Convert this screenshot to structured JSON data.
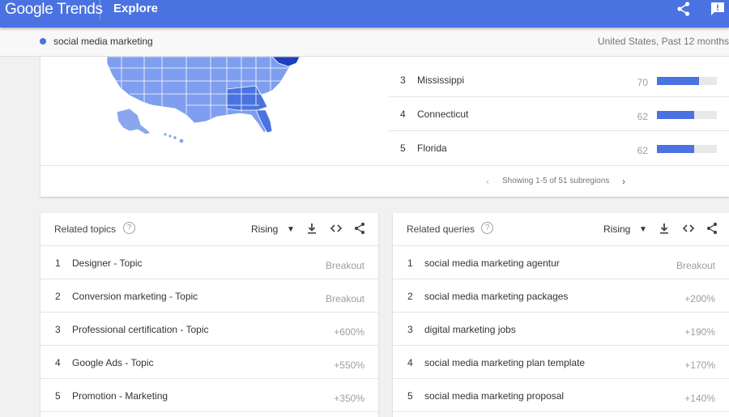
{
  "header": {
    "logo_google": "Google",
    "logo_trends": "Trends",
    "section": "Explore"
  },
  "search": {
    "term": "social media marketing",
    "scope": "United States, Past 12 months"
  },
  "colors": {
    "accent": "#4a72e0",
    "map_light": "#8aa6ee",
    "map_dark": "#2548c8"
  },
  "icons": {
    "share": "share-icon",
    "feedback": "feedback-icon",
    "help": "help-icon",
    "download": "download-icon",
    "embed": "embed-icon"
  },
  "regions": {
    "rows": [
      {
        "rank": "3",
        "name": "Mississippi",
        "value": "70",
        "fraction": 0.7
      },
      {
        "rank": "4",
        "name": "Connecticut",
        "value": "62",
        "fraction": 0.62
      },
      {
        "rank": "5",
        "name": "Florida",
        "value": "62",
        "fraction": 0.62
      }
    ],
    "pager_text": "Showing 1-5 of 51 subregions",
    "prev": "‹",
    "next": "›"
  },
  "related_topics": {
    "title": "Related topics",
    "help": "?",
    "sort": "Rising",
    "rows": [
      {
        "rank": "1",
        "label": "Designer - Topic",
        "metric": "Breakout"
      },
      {
        "rank": "2",
        "label": "Conversion marketing - Topic",
        "metric": "Breakout"
      },
      {
        "rank": "3",
        "label": "Professional certification - Topic",
        "metric": "+600%"
      },
      {
        "rank": "4",
        "label": "Google Ads - Topic",
        "metric": "+550%"
      },
      {
        "rank": "5",
        "label": "Promotion - Marketing",
        "metric": "+350%"
      }
    ]
  },
  "related_queries": {
    "title": "Related queries",
    "help": "?",
    "sort": "Rising",
    "rows": [
      {
        "rank": "1",
        "label": "social media marketing agentur",
        "metric": "Breakout"
      },
      {
        "rank": "2",
        "label": "social media marketing packages",
        "metric": "+200%"
      },
      {
        "rank": "3",
        "label": "digital marketing jobs",
        "metric": "+190%"
      },
      {
        "rank": "4",
        "label": "social media marketing plan template",
        "metric": "+170%"
      },
      {
        "rank": "5",
        "label": "social media marketing proposal",
        "metric": "+140%"
      }
    ]
  }
}
